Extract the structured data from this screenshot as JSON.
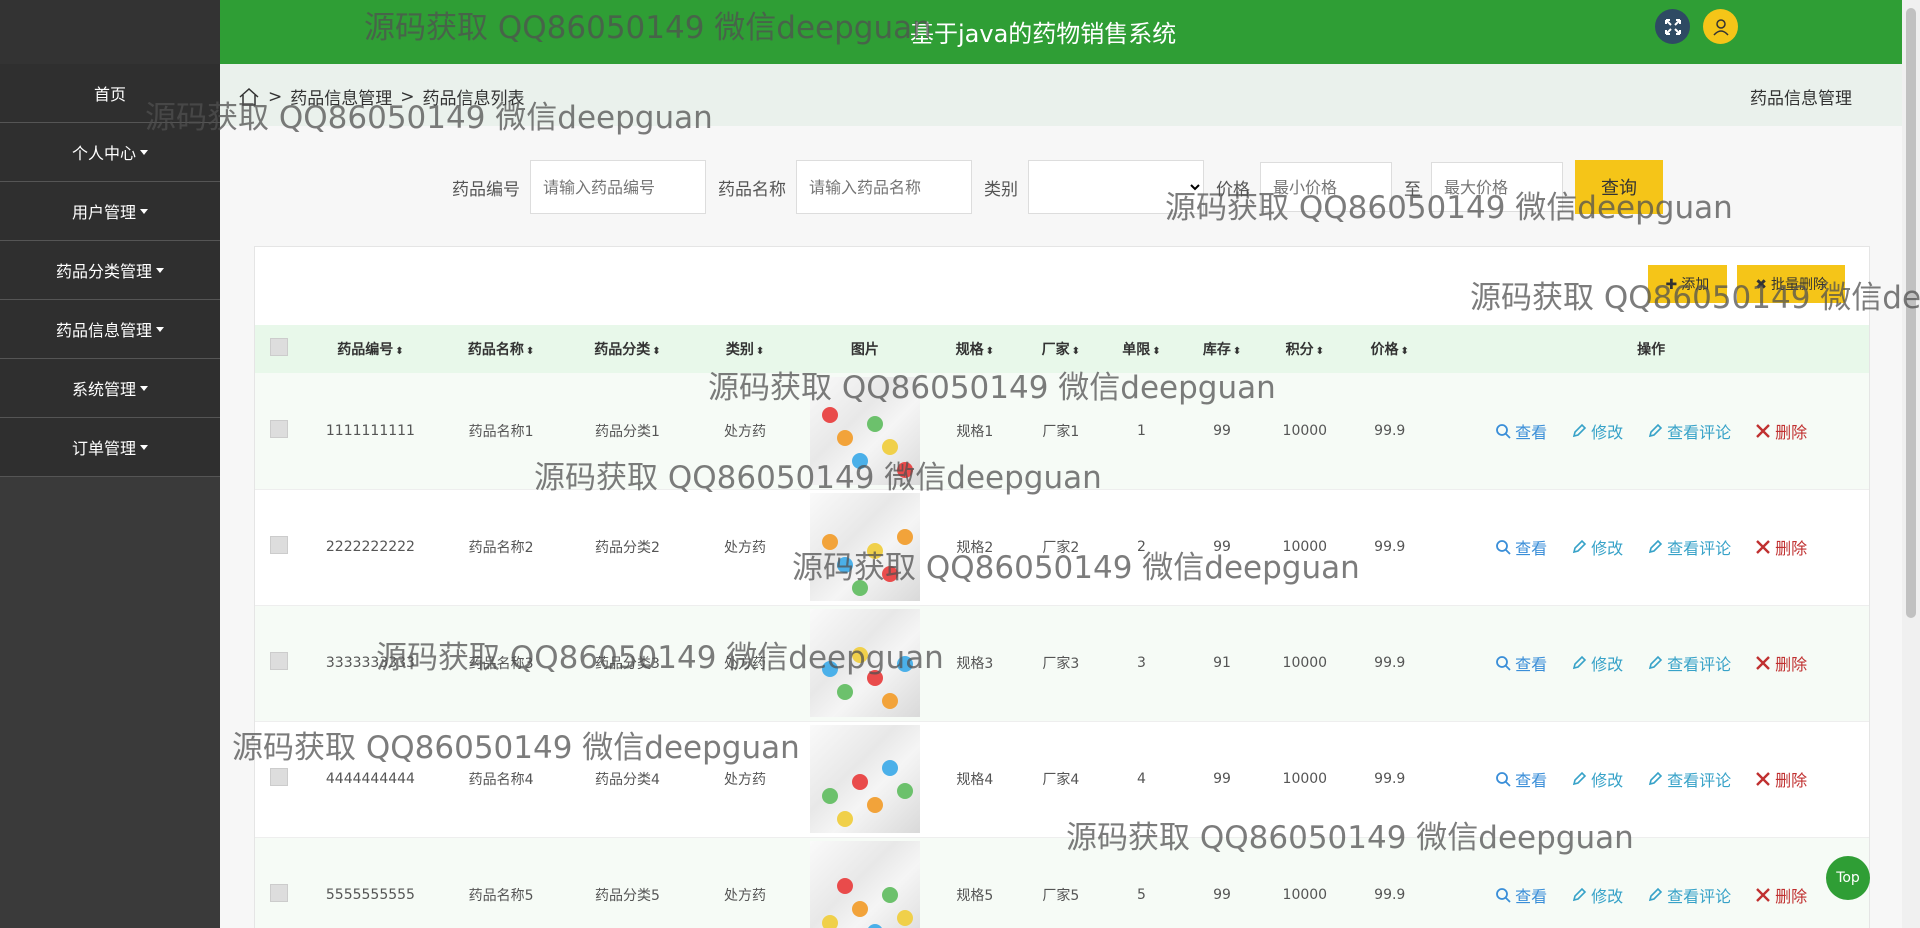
{
  "header": {
    "title": "基于java的药物销售系统"
  },
  "sidebar": {
    "items": [
      {
        "label": "首页",
        "caret": false
      },
      {
        "label": "个人中心",
        "caret": true
      },
      {
        "label": "用户管理",
        "caret": true
      },
      {
        "label": "药品分类管理",
        "caret": true
      },
      {
        "label": "药品信息管理",
        "caret": true
      },
      {
        "label": "系统管理",
        "caret": true
      },
      {
        "label": "订单管理",
        "caret": true
      }
    ]
  },
  "breadcrumb": {
    "level1": "药品信息管理",
    "level2": "药品信息列表",
    "sep": ">",
    "right": "药品信息管理"
  },
  "search": {
    "code_label": "药品编号",
    "code_placeholder": "请输入药品编号",
    "name_label": "药品名称",
    "name_placeholder": "请输入药品名称",
    "type_label": "类别",
    "price_label": "价格",
    "min_placeholder": "最小价格",
    "to": "至",
    "max_placeholder": "最大价格",
    "query": "查询"
  },
  "toolbar": {
    "add": "添加",
    "batch_delete": "批量删除"
  },
  "table": {
    "headers": [
      "药品编号",
      "药品名称",
      "药品分类",
      "类别",
      "图片",
      "规格",
      "厂家",
      "单限",
      "库存",
      "积分",
      "价格",
      "操作"
    ],
    "rows": [
      {
        "code": "1111111111",
        "name": "药品名称1",
        "cat": "药品分类1",
        "type": "处方药",
        "spec": "规格1",
        "maker": "厂家1",
        "limit": "1",
        "stock": "99",
        "points": "10000",
        "price": "99.9"
      },
      {
        "code": "2222222222",
        "name": "药品名称2",
        "cat": "药品分类2",
        "type": "处方药",
        "spec": "规格2",
        "maker": "厂家2",
        "limit": "2",
        "stock": "99",
        "points": "10000",
        "price": "99.9"
      },
      {
        "code": "3333333333",
        "name": "药品名称3",
        "cat": "药品分类3",
        "type": "处方药",
        "spec": "规格3",
        "maker": "厂家3",
        "limit": "3",
        "stock": "91",
        "points": "10000",
        "price": "99.9"
      },
      {
        "code": "4444444444",
        "name": "药品名称4",
        "cat": "药品分类4",
        "type": "处方药",
        "spec": "规格4",
        "maker": "厂家4",
        "limit": "4",
        "stock": "99",
        "points": "10000",
        "price": "99.9"
      },
      {
        "code": "5555555555",
        "name": "药品名称5",
        "cat": "药品分类5",
        "type": "处方药",
        "spec": "规格5",
        "maker": "厂家5",
        "limit": "5",
        "stock": "99",
        "points": "10000",
        "price": "99.9"
      }
    ],
    "ops": {
      "view": "查看",
      "edit": "修改",
      "comment": "查看评论",
      "delete": "删除"
    }
  },
  "top_button": "Top",
  "watermark": "源码获取 QQ86050149 微信deepguan",
  "colors": {
    "header": "#2f9e35",
    "accent": "#f5c518",
    "sidebar": "#2f2f2f"
  }
}
